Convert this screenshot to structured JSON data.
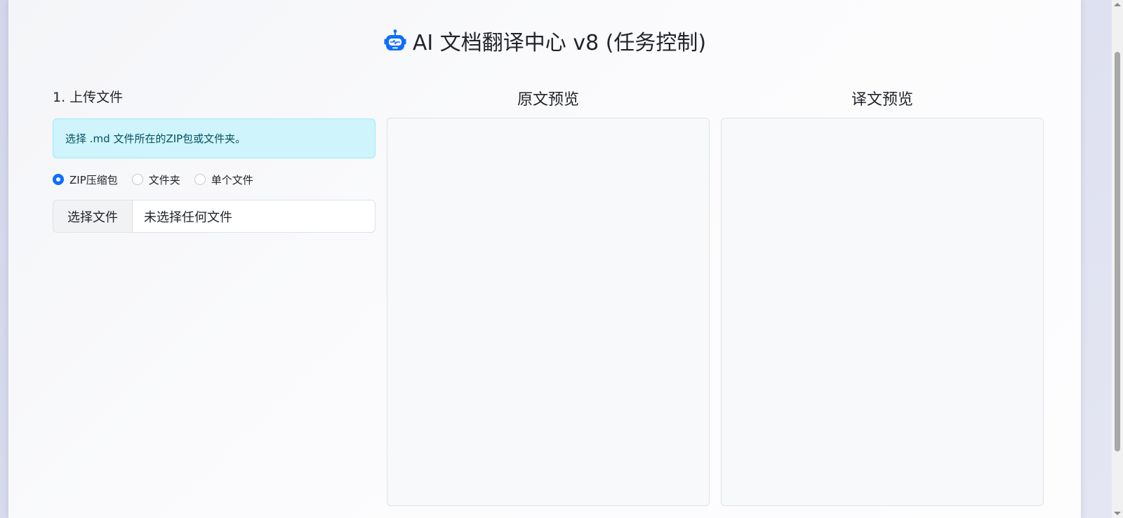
{
  "page": {
    "title": "AI 文档翻译中心 v8 (任务控制)",
    "title_icon": "robot-icon"
  },
  "upload": {
    "heading": "1. 上传文件",
    "info_message": "选择 .md 文件所在的ZIP包或文件夹。",
    "mode_options": [
      {
        "label": "ZIP压缩包",
        "checked": true
      },
      {
        "label": "文件夹",
        "checked": false
      },
      {
        "label": "单个文件",
        "checked": false
      }
    ],
    "file_button_label": "选择文件",
    "file_status": "未选择任何文件"
  },
  "previews": {
    "source_heading": "原文预览",
    "target_heading": "译文预览"
  },
  "colors": {
    "accent": "#0d6efd",
    "info_background": "#cff4fc",
    "info_text": "#055160",
    "info_border": "#9eeaf9",
    "robot_icon": "#0d6efd"
  }
}
